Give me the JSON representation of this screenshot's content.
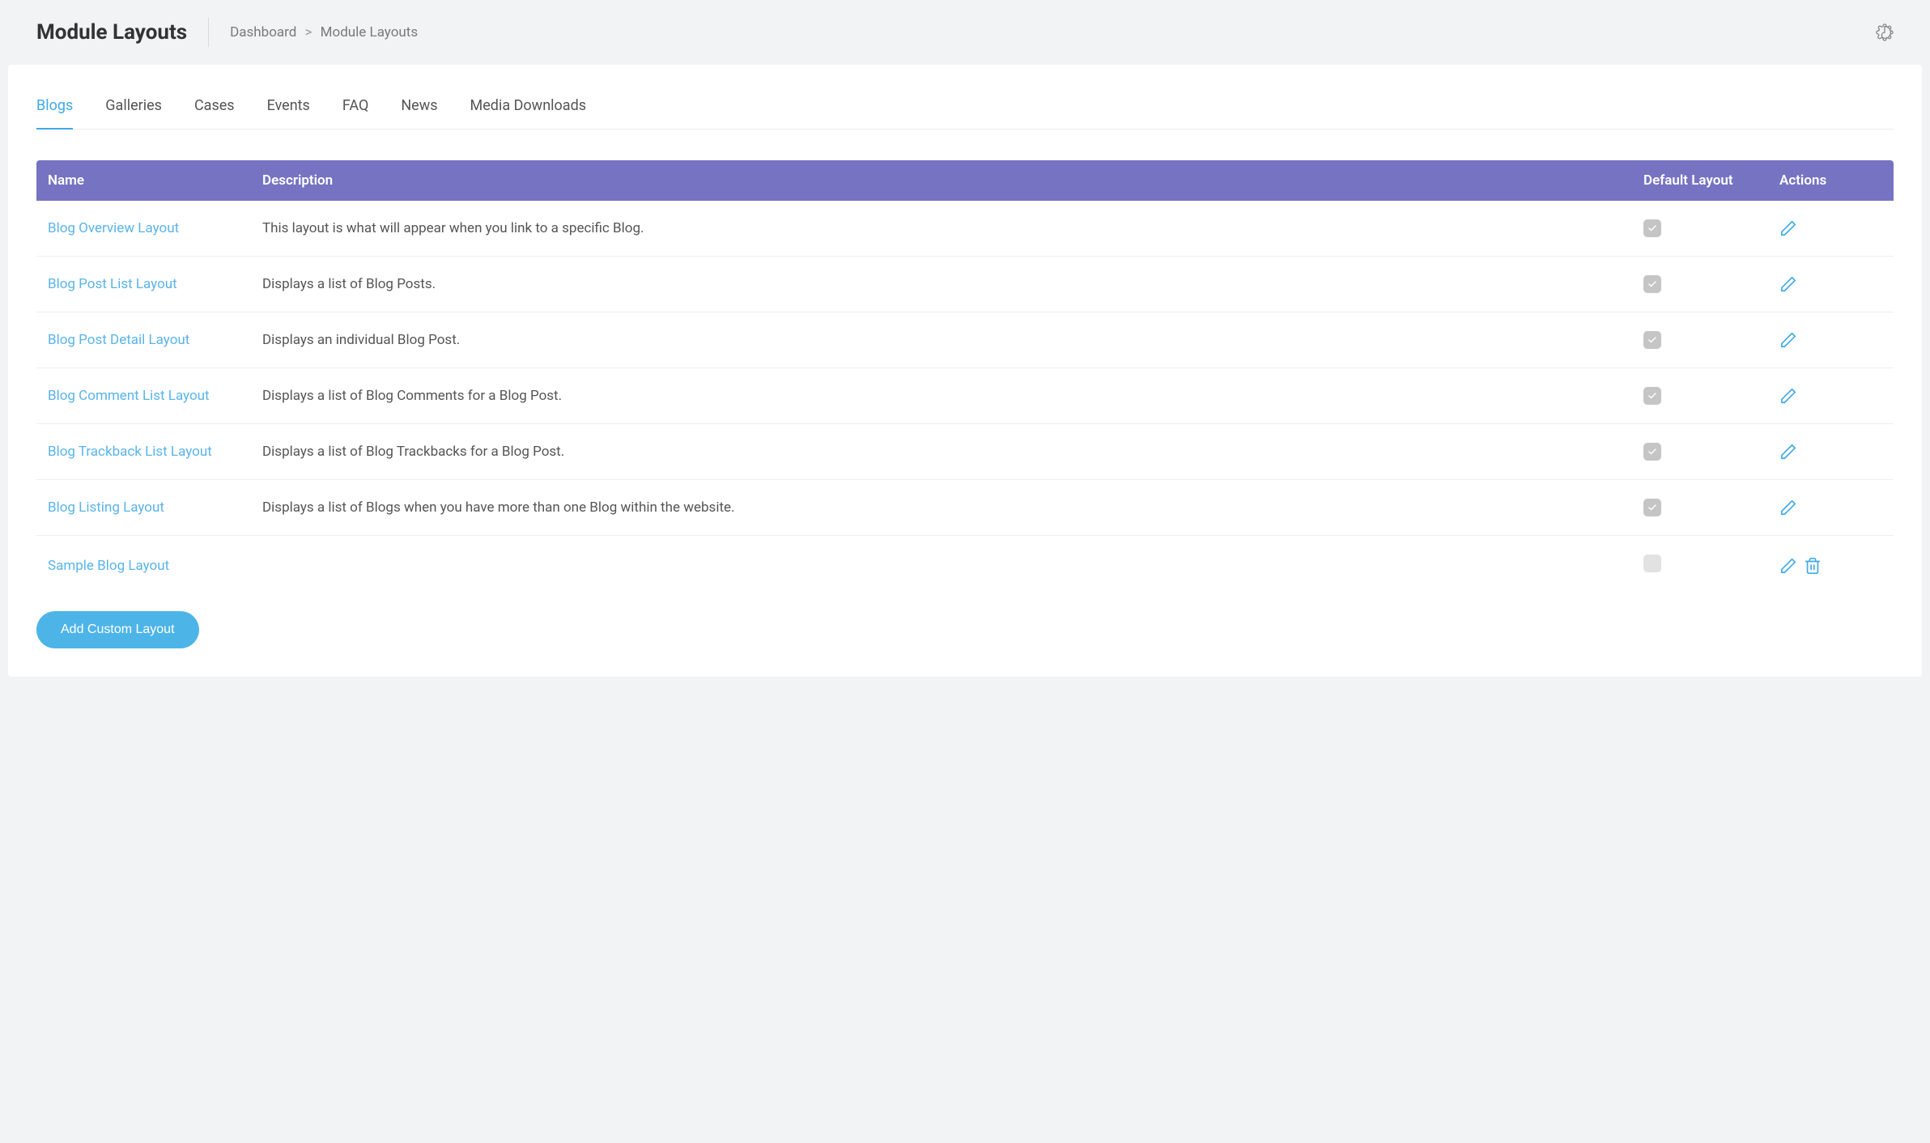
{
  "header": {
    "title": "Module Layouts",
    "breadcrumb": {
      "root": "Dashboard",
      "current": "Module Layouts"
    }
  },
  "tabs": [
    {
      "label": "Blogs",
      "active": true
    },
    {
      "label": "Galleries",
      "active": false
    },
    {
      "label": "Cases",
      "active": false
    },
    {
      "label": "Events",
      "active": false
    },
    {
      "label": "FAQ",
      "active": false
    },
    {
      "label": "News",
      "active": false
    },
    {
      "label": "Media Downloads",
      "active": false
    }
  ],
  "table": {
    "columns": {
      "name": "Name",
      "description": "Description",
      "default_layout": "Default Layout",
      "actions": "Actions"
    },
    "rows": [
      {
        "name": "Blog Overview Layout",
        "description": "This layout is what will appear when you link to a specific Blog.",
        "default": true,
        "deletable": false
      },
      {
        "name": "Blog Post List Layout",
        "description": "Displays a list of Blog Posts.",
        "default": true,
        "deletable": false
      },
      {
        "name": "Blog Post Detail Layout",
        "description": "Displays an individual Blog Post.",
        "default": true,
        "deletable": false
      },
      {
        "name": "Blog Comment List Layout",
        "description": "Displays a list of Blog Comments for a Blog Post.",
        "default": true,
        "deletable": false
      },
      {
        "name": "Blog Trackback List Layout",
        "description": "Displays a list of Blog Trackbacks for a Blog Post.",
        "default": true,
        "deletable": false
      },
      {
        "name": "Blog Listing Layout",
        "description": "Displays a list of Blogs when you have more than one Blog within the website.",
        "default": true,
        "deletable": false
      },
      {
        "name": "Sample Blog Layout",
        "description": "",
        "default": false,
        "deletable": true
      }
    ]
  },
  "buttons": {
    "add_custom_layout": "Add Custom Layout"
  },
  "icons": {
    "gear": "gear-icon",
    "edit": "pencil-icon",
    "delete": "trash-icon",
    "check": "check-icon"
  }
}
